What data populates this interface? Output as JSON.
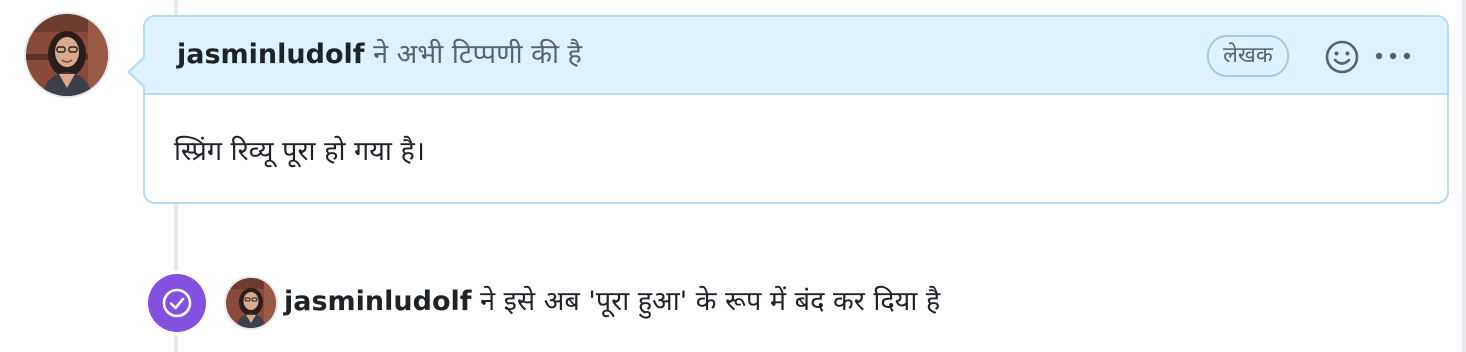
{
  "comment": {
    "author": "jasminludolf",
    "action_text": "ने अभी टिप्पणी की है",
    "author_badge": "लेखक",
    "body": "स्प्रिंग रिव्यू पूरा हो गया है।",
    "emoji_icon": "smiley-icon",
    "more_icon": "kebab-horizontal-icon"
  },
  "event": {
    "author": "jasminludolf",
    "action_text": "ने इसे अब 'पूरा हुआ' के रूप में बंद कर दिया है",
    "icon": "check-circle-icon",
    "badge_color": "#8251df"
  },
  "colors": {
    "header_bg": "#ddf2fc",
    "header_border": "#b6dcf2",
    "timeline": "#e6e8eb",
    "muted_text": "#59636e"
  }
}
